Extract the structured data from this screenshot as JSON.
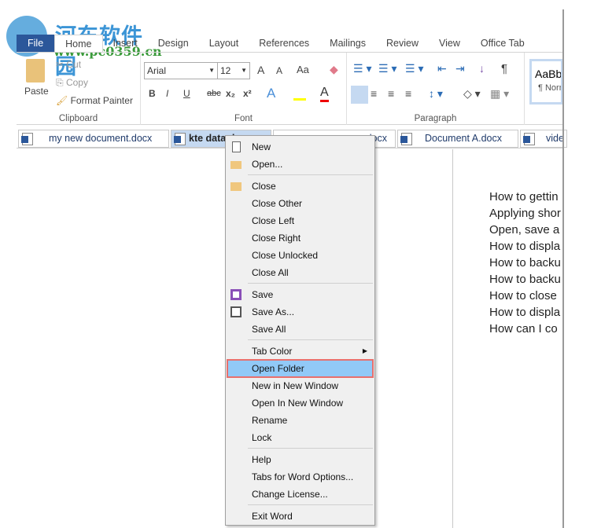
{
  "watermark": {
    "text_cn": "河东软件园",
    "url": "www.pc0359.cn"
  },
  "ribbon_tabs": [
    "File",
    "Home",
    "Insert",
    "Design",
    "Layout",
    "References",
    "Mailings",
    "Review",
    "View",
    "Office Tab"
  ],
  "clipboard": {
    "label": "Clipboard",
    "paste": "Paste",
    "cut": "Cut",
    "copy": "Copy",
    "format_painter": "Format Painter"
  },
  "font": {
    "label": "Font",
    "name": "Arial",
    "size": "12",
    "bold": "B",
    "italic": "I",
    "underline": "U",
    "strike": "abc",
    "sub": "x₂",
    "sup": "x²",
    "grow": "A",
    "shrink": "A",
    "case": "Aa"
  },
  "paragraph": {
    "label": "Paragraph",
    "pilcrow": "¶"
  },
  "styles": {
    "preview": "AaBb",
    "name": "¶ Norm"
  },
  "doc_tabs": [
    {
      "label": "my new document.docx"
    },
    {
      "label": "kte data.docx",
      "active": true
    },
    {
      "label": "docx"
    },
    {
      "label": "Document A.docx"
    },
    {
      "label": "vide"
    }
  ],
  "document_lines": [
    "How to gettin",
    "Applying shor",
    "Open, save a",
    "How to displa",
    "How to backu",
    "How to backu",
    "How to close",
    "How to displa",
    "How can I co"
  ],
  "context_menu": {
    "items": [
      {
        "label": "New",
        "icon": "new-document-icon"
      },
      {
        "label": "Open...",
        "icon": "folder-open-icon"
      },
      {
        "sep": true
      },
      {
        "label": "Close",
        "icon": "folder-close-icon"
      },
      {
        "label": "Close Other"
      },
      {
        "label": "Close Left"
      },
      {
        "label": "Close Right"
      },
      {
        "label": "Close Unlocked"
      },
      {
        "label": "Close All"
      },
      {
        "sep": true
      },
      {
        "label": "Save",
        "icon": "save-icon"
      },
      {
        "label": "Save As...",
        "icon": "save-as-icon"
      },
      {
        "label": "Save All"
      },
      {
        "sep": true
      },
      {
        "label": "Tab Color",
        "submenu": true
      },
      {
        "label": "Open Folder",
        "highlighted": true
      },
      {
        "label": "New in New Window"
      },
      {
        "label": "Open In New Window"
      },
      {
        "label": "Rename"
      },
      {
        "label": "Lock"
      },
      {
        "sep": true
      },
      {
        "label": "Help"
      },
      {
        "label": "Tabs for Word Options..."
      },
      {
        "label": "Change License..."
      },
      {
        "sep": true
      },
      {
        "label": "Exit Word"
      }
    ]
  },
  "colors": {
    "accent": "#2b579a",
    "highlight": "#91c9f7",
    "highlight_border": "#e8706d",
    "active_tab": "#c5d9f1"
  }
}
